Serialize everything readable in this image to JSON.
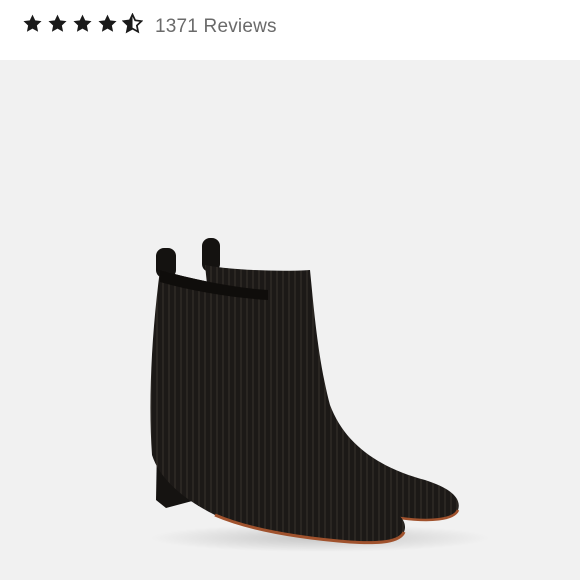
{
  "rating": {
    "stars_filled": 4.5,
    "stars_total": 5,
    "reviews_label": "1371 Reviews",
    "star_color": "#1a1a1a"
  },
  "product_image": {
    "subject": "boots-icon",
    "background_color": "#f1f1f1"
  },
  "colors": {
    "text_muted": "#6a6a6a",
    "boot_knit": "#1c1917",
    "sole": "#a0522d"
  }
}
